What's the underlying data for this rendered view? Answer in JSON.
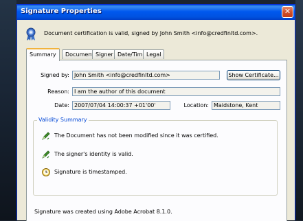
{
  "window": {
    "title": "Signature Properties",
    "close_glyph": "✕"
  },
  "header": {
    "certification_text": "Document certification is valid, signed by John Smith <info@credfinltd.com>."
  },
  "tabs": [
    {
      "label": "Summary",
      "active": true
    },
    {
      "label": "Document",
      "active": false
    },
    {
      "label": "Signer",
      "active": false
    },
    {
      "label": "Date/Time",
      "active": false
    },
    {
      "label": "Legal",
      "active": false
    }
  ],
  "summary": {
    "signed_by_label": "Signed by:",
    "signed_by_value": "John Smith <info@credfinltd.com>",
    "show_certificate_label": "Show Certificate...",
    "reason_label": "Reason:",
    "reason_value": "I am the author of this document",
    "date_label": "Date:",
    "date_value": "2007/07/04 14:00:37 +01'00'",
    "location_label": "Location:",
    "location_value": "Maidstone, Kent"
  },
  "validity": {
    "title": "Validity Summary",
    "items": [
      {
        "text": "The Document has not been modified since it was certified.",
        "icon": "pen-check-icon"
      },
      {
        "text": "The signer's identity is valid.",
        "icon": "pen-check-icon"
      },
      {
        "text": "Signature is timestamped.",
        "icon": "clock-icon"
      }
    ]
  },
  "footer": {
    "created_text": "Signature was created using Adobe Acrobat 8.1.0."
  },
  "colors": {
    "titlebar": "#0058ee",
    "dialog_bg": "#ece9d8",
    "group_title": "#0046d5",
    "active_tab_accent": "#f1b33c"
  }
}
